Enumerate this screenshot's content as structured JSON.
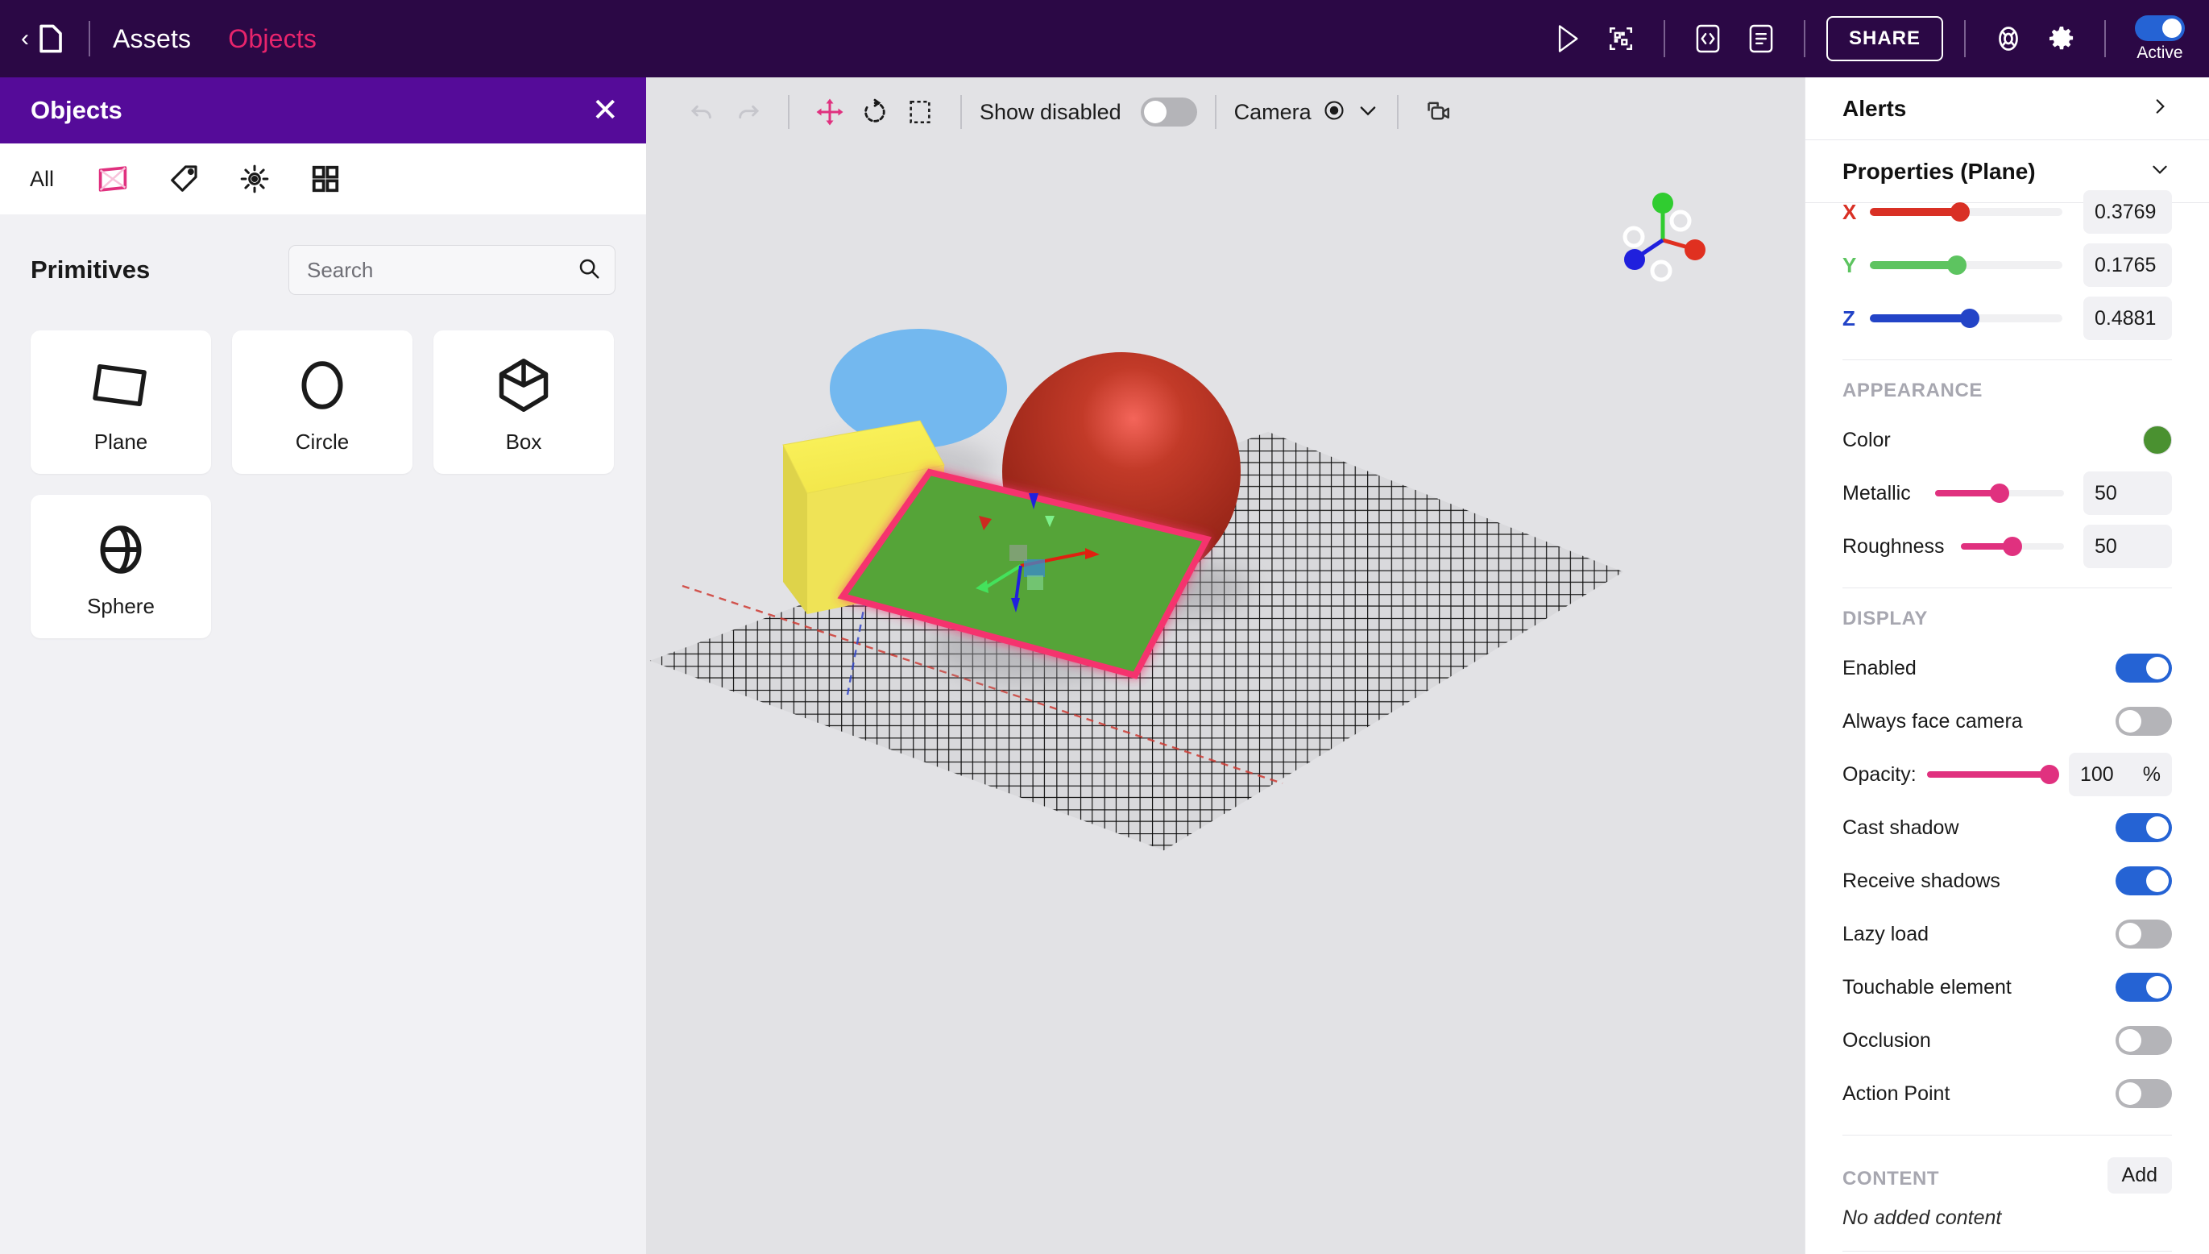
{
  "topbar": {
    "back_icon": "chevron-left-icon",
    "folder_icon": "folder-icon",
    "breadcrumbs": [
      {
        "label": "Assets",
        "active": false
      },
      {
        "label": "Objects",
        "active": true
      }
    ],
    "actions": [
      {
        "name": "play-icon",
        "label": "Play"
      },
      {
        "name": "qr-code-icon",
        "label": "QR Code"
      },
      {
        "name": "code-icon",
        "label": "Code"
      },
      {
        "name": "document-icon",
        "label": "Document"
      },
      {
        "name": "share-button",
        "label": "SHARE"
      },
      {
        "name": "help-icon",
        "label": "Help"
      },
      {
        "name": "gear-icon",
        "label": "Settings"
      }
    ],
    "share_label": "SHARE",
    "active_toggle": {
      "label": "Active",
      "state": "on"
    },
    "accent_color": "#e8246c",
    "bg_color": "#2b0845"
  },
  "left_panel": {
    "title": "Objects",
    "close_icon": "close-icon",
    "header_color": "#550b99",
    "tabs": [
      {
        "name": "tab-all",
        "label": "All",
        "icon": null,
        "active": false
      },
      {
        "name": "tab-primitives",
        "label": "",
        "icon": "plane-icon",
        "active": true
      },
      {
        "name": "tab-tags",
        "label": "",
        "icon": "tag-icon",
        "active": false
      },
      {
        "name": "tab-lights",
        "label": "",
        "icon": "light-icon",
        "active": false
      },
      {
        "name": "tab-grid",
        "label": "",
        "icon": "grid-icon",
        "active": false
      }
    ],
    "section_title": "Primitives",
    "search": {
      "value": "",
      "placeholder": "Search",
      "icon": "search-icon"
    },
    "primitives": [
      {
        "label": "Plane",
        "icon": "plane-icon"
      },
      {
        "label": "Circle",
        "icon": "circle-icon"
      },
      {
        "label": "Box",
        "icon": "box-icon"
      },
      {
        "label": "Sphere",
        "icon": "sphere-icon"
      }
    ]
  },
  "viewport": {
    "toolbar": {
      "undo_icon": "undo-icon",
      "redo_icon": "redo-icon",
      "move_icon": "move-tool-icon",
      "rotate_icon": "rotate-tool-icon",
      "scale_icon": "scale-tool-icon",
      "active_tool": "move",
      "show_disabled_label": "Show disabled",
      "show_disabled_state": "off",
      "camera_label": "Camera",
      "camera_icon": "radio-dot-icon",
      "camera_chevron": "chevron-down-icon",
      "duplicate_camera_icon": "duplicate-camera-icon"
    },
    "nav_gizmo": {
      "x_color": "#e03020",
      "y_color": "#30cc30",
      "z_color": "#2020dd"
    },
    "background_color": "#e2e2e5",
    "objects": [
      {
        "name": "circle",
        "color": "#73b8ef",
        "type": "circle"
      },
      {
        "name": "sphere",
        "color": "#a82a1e",
        "type": "sphere"
      },
      {
        "name": "box",
        "color": "#f5ea4e",
        "type": "box"
      },
      {
        "name": "plane",
        "color": "#55a438",
        "type": "plane",
        "selected": true,
        "selection_color": "#f5336e"
      }
    ]
  },
  "right_panel": {
    "alerts": {
      "title": "Alerts",
      "chevron": "chevron-right-icon"
    },
    "properties": {
      "title": "Properties (Plane)",
      "chevron": "chevron-down-icon"
    },
    "transform": [
      {
        "axis": "X",
        "value": "0.3769",
        "color": "#d93025",
        "pct": 47,
        "clipped": true
      },
      {
        "axis": "Y",
        "value": "0.1765",
        "color": "#5dc460",
        "pct": 45,
        "clipped": false
      },
      {
        "axis": "Z",
        "value": "0.4881",
        "color": "#2344c7",
        "pct": 52,
        "clipped": false
      }
    ],
    "appearance": {
      "title": "APPEARANCE",
      "color_label": "Color",
      "color_value": "#4a9130",
      "metallic_label": "Metallic",
      "metallic_value": "50",
      "metallic_pct": 50,
      "roughness_label": "Roughness",
      "roughness_value": "50",
      "roughness_pct": 50
    },
    "display": {
      "title": "DISPLAY",
      "items": [
        {
          "label": "Enabled",
          "type": "toggle",
          "state": "on"
        },
        {
          "label": "Always face camera",
          "type": "toggle",
          "state": "off"
        },
        {
          "label": "Opacity:",
          "type": "slider",
          "value": "100",
          "unit": "%",
          "pct": 100
        },
        {
          "label": "Cast shadow",
          "type": "toggle",
          "state": "on"
        },
        {
          "label": "Receive shadows",
          "type": "toggle",
          "state": "on"
        },
        {
          "label": "Lazy load",
          "type": "toggle",
          "state": "off"
        },
        {
          "label": "Touchable element",
          "type": "toggle",
          "state": "on"
        },
        {
          "label": "Occlusion",
          "type": "toggle",
          "state": "off"
        },
        {
          "label": "Action Point",
          "type": "toggle",
          "state": "off"
        }
      ]
    },
    "content": {
      "title": "CONTENT",
      "add_label": "Add",
      "empty_text": "No added content"
    }
  }
}
